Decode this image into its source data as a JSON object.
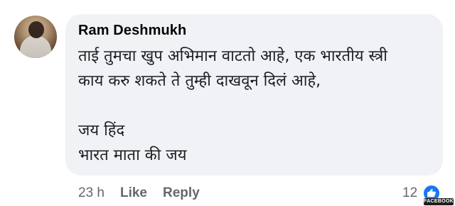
{
  "comment": {
    "author": "Ram Deshmukh",
    "text": "ताई तुमचा खुप अभिमान वाटतो आहे, एक भारतीय स्त्री\nकाय करु शकते ते तुम्ही दाखवून दिलं आहे,\n\nजय हिंद\nभारत माता की जय",
    "time": "23 h",
    "like_label": "Like",
    "reply_label": "Reply",
    "reaction_count": "12"
  },
  "watermark": {
    "label": "FACEBOOK"
  },
  "colors": {
    "bubble": "#f0f2f5",
    "author": "#050505",
    "meta": "#65676b",
    "like_blue": "#1877f2"
  }
}
